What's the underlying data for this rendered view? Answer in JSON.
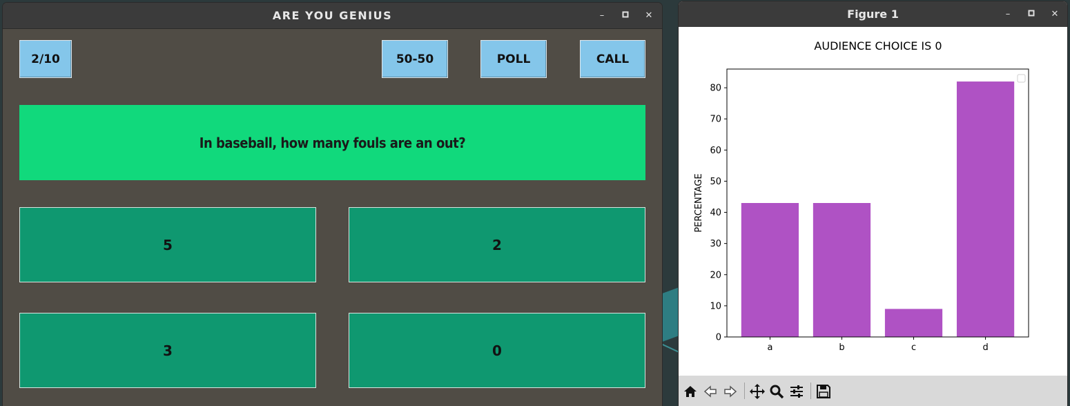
{
  "quiz_window": {
    "title": "ARE YOU GENIUS",
    "minimize_glyph": "–",
    "maximize_glyph": "▪",
    "close_glyph": "✕",
    "progress": "2/10",
    "lifelines": {
      "fifty_fifty": "50-50",
      "poll": "POLL",
      "call": "CALL"
    },
    "question": "In baseball, how many fouls are an out?",
    "answers": [
      "5",
      "2",
      "3",
      "0"
    ],
    "colors": {
      "background": "#504c45",
      "lifeline_button": "#84c6ea",
      "question_box": "#11d97c",
      "answer_box": "#0f9870"
    }
  },
  "figure_window": {
    "title": "Figure 1",
    "minimize_glyph": "–",
    "maximize_glyph": "▪",
    "close_glyph": "✕",
    "toolbar_icons": [
      "home-icon",
      "back-arrow-icon",
      "forward-arrow-icon",
      "pan-move-icon",
      "zoom-magnifier-icon",
      "configure-subplots-icon",
      "save-disk-icon"
    ]
  },
  "chart_data": {
    "type": "bar",
    "title": "AUDIENCE CHOICE IS 0",
    "xlabel": "",
    "ylabel": "PERCENTAGE",
    "categories": [
      "a",
      "b",
      "c",
      "d"
    ],
    "values": [
      43,
      43,
      9,
      82
    ],
    "ylim": [
      0,
      86
    ],
    "yticks": [
      0,
      10,
      20,
      30,
      40,
      50,
      60,
      70,
      80
    ],
    "bar_color": "#af52c4",
    "legend": "top-right",
    "grid": false
  }
}
